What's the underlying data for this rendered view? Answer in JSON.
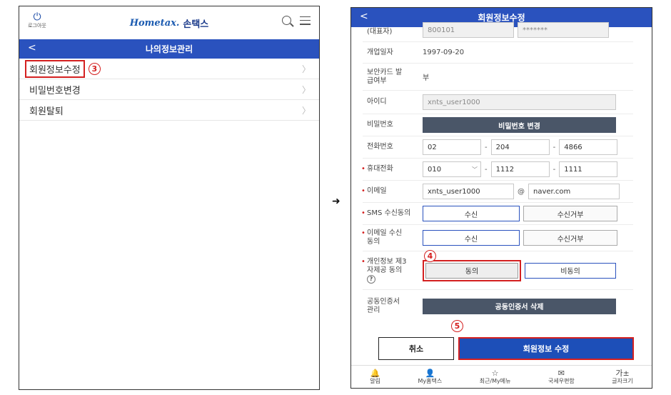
{
  "left": {
    "logout_label": "로그아웃",
    "brand_logo": "Hometax.",
    "brand_name": "손택스",
    "title": "나의정보관리",
    "menu": [
      {
        "label": "회원정보수정"
      },
      {
        "label": "비밀번호변경"
      },
      {
        "label": "회원탈퇴"
      }
    ],
    "step_marker": "3"
  },
  "arrow": "➜",
  "right": {
    "title": "회원정보수정",
    "top_partial_label": "(대표자)",
    "top_partial_value": "800101",
    "top_partial_mask": "*******",
    "open_date_label": "개업일자",
    "open_date_value": "1997-09-20",
    "security_card_label": "보안카드 발급여부",
    "security_card_value": "부",
    "id_label": "아이디",
    "id_value": "xnts_user1000",
    "password_label": "비밀번호",
    "password_button": "비밀번호 변경",
    "phone_label": "전화번호",
    "phone": [
      "02",
      "204",
      "4866"
    ],
    "mobile_label": "휴대전화",
    "mobile": [
      "010",
      "1112",
      "1111"
    ],
    "email_label": "이메일",
    "email_user": "xnts_user1000",
    "email_at": "@",
    "email_domain": "naver.com",
    "sms_label": "SMS 수신동의",
    "email_consent_label": "이메일 수신동의",
    "receive": "수신",
    "reject": "수신거부",
    "third_party_label": "개인정보 제3자제공 동의",
    "help": "?",
    "agree": "동의",
    "disagree": "비동의",
    "cert_label": "공동인증서 관리",
    "cert_button": "공동인증서 삭제",
    "cancel": "취소",
    "submit": "회원정보 수정",
    "step4": "4",
    "step5": "5",
    "tabs": [
      {
        "icon": "🔔",
        "label": "알림"
      },
      {
        "icon": "👤",
        "label": "My홈택스"
      },
      {
        "icon": "☆",
        "label": "최근/My메뉴"
      },
      {
        "icon": "✉",
        "label": "국세우편함"
      },
      {
        "icon": "가±",
        "label": "글자크기"
      }
    ]
  }
}
